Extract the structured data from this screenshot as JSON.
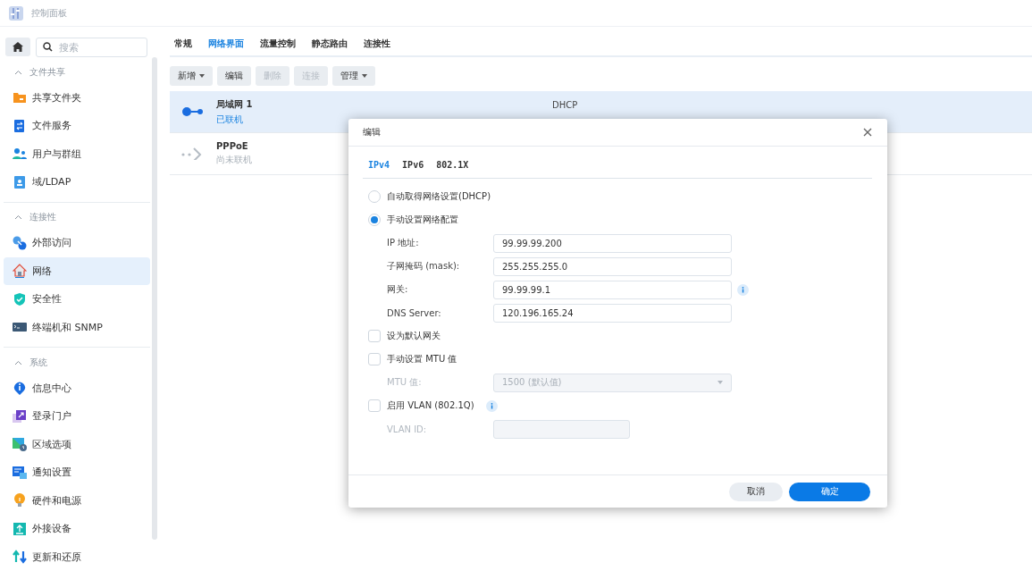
{
  "window": {
    "title": "控制面板"
  },
  "sidebar": {
    "search": {
      "placeholder": "搜索"
    },
    "sections": [
      {
        "title": "文件共享",
        "expanded": true,
        "items": [
          {
            "label": "共享文件夹",
            "selected": false
          },
          {
            "label": "文件服务",
            "selected": false
          },
          {
            "label": "用户与群组",
            "selected": false
          },
          {
            "label": "域/LDAP",
            "selected": false
          }
        ]
      },
      {
        "title": "连接性",
        "expanded": true,
        "items": [
          {
            "label": "外部访问",
            "selected": false
          },
          {
            "label": "网络",
            "selected": true
          },
          {
            "label": "安全性",
            "selected": false
          },
          {
            "label": "终端机和 SNMP",
            "selected": false
          }
        ]
      },
      {
        "title": "系统",
        "expanded": true,
        "items": [
          {
            "label": "信息中心",
            "selected": false
          },
          {
            "label": "登录门户",
            "selected": false
          },
          {
            "label": "区域选项",
            "selected": false
          },
          {
            "label": "通知设置",
            "selected": false
          },
          {
            "label": "硬件和电源",
            "selected": false
          },
          {
            "label": "外接设备",
            "selected": false
          },
          {
            "label": "更新和还原",
            "selected": false
          }
        ]
      }
    ]
  },
  "tabs": [
    {
      "label": "常规",
      "selected": false
    },
    {
      "label": "网络界面",
      "selected": true
    },
    {
      "label": "流量控制",
      "selected": false
    },
    {
      "label": "静态路由",
      "selected": false
    },
    {
      "label": "连接性",
      "selected": false
    }
  ],
  "toolbar": [
    {
      "label": "新增",
      "dropdown": true,
      "disabled": false
    },
    {
      "label": "编辑",
      "dropdown": false,
      "disabled": false
    },
    {
      "label": "删除",
      "dropdown": false,
      "disabled": true
    },
    {
      "label": "连接",
      "dropdown": false,
      "disabled": true
    },
    {
      "label": "管理",
      "dropdown": true,
      "disabled": false
    }
  ],
  "interfaces": [
    {
      "name": "局域网 1",
      "status": "已联机",
      "connected": true,
      "selected": true,
      "column_3": "DHCP"
    },
    {
      "name": "PPPoE",
      "status": "尚未联机",
      "connected": false,
      "selected": false
    }
  ],
  "dialog": {
    "title": "编辑",
    "tabs": [
      {
        "label": "IPv4",
        "selected": true
      },
      {
        "label": "IPv6",
        "selected": false
      },
      {
        "label": "802.1X",
        "selected": false
      }
    ],
    "options": [
      {
        "kind": "radio",
        "label": "自动取得网络设置(DHCP)",
        "selected": false
      },
      {
        "kind": "radio",
        "label": "手动设置网络配置",
        "selected": true
      },
      {
        "kind": "field",
        "label": "IP 地址:",
        "value": "99.99.99.200",
        "disabled": false,
        "info": false
      },
      {
        "kind": "field",
        "label": "子网掩码 (mask):",
        "value": "255.255.255.0",
        "disabled": false,
        "info": false
      },
      {
        "kind": "field",
        "label": "网关:",
        "value": "99.99.99.1",
        "disabled": false,
        "info": true
      },
      {
        "kind": "field",
        "label": "DNS Server:",
        "value": "120.196.165.24",
        "disabled": false,
        "info": false
      },
      {
        "kind": "checkbox",
        "label": "设为默认网关",
        "checked": false,
        "info": false
      },
      {
        "kind": "checkbox",
        "label": "手动设置 MTU 值",
        "checked": false,
        "info": false
      },
      {
        "kind": "select",
        "label": "MTU 值:",
        "value": "1500 (默认值)",
        "disabled": true
      },
      {
        "kind": "checkbox",
        "label": "启用 VLAN (802.1Q)",
        "checked": false,
        "info": true
      },
      {
        "kind": "small-field",
        "label": "VLAN ID:",
        "disabled": true
      }
    ],
    "buttons": [
      {
        "label": "取消",
        "primary": false
      },
      {
        "label": "确定",
        "primary": true
      }
    ]
  }
}
